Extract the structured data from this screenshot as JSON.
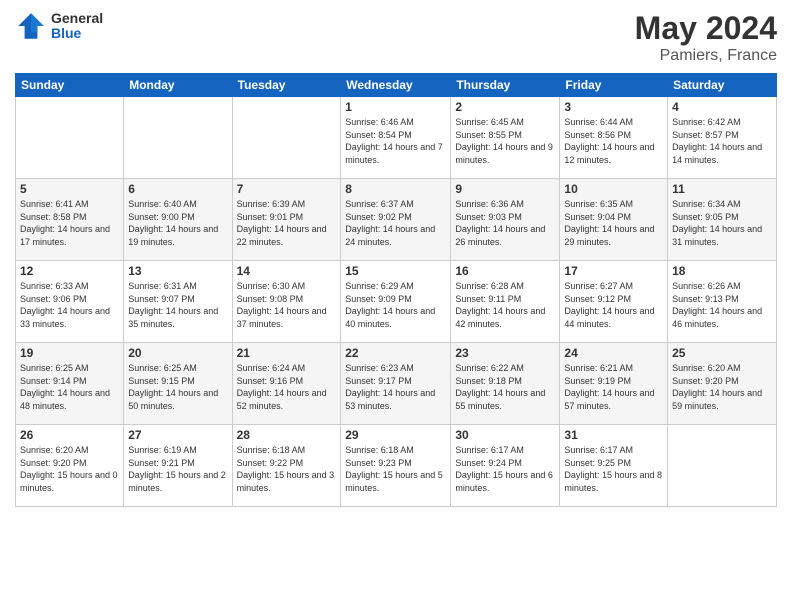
{
  "header": {
    "logo_general": "General",
    "logo_blue": "Blue",
    "month_title": "May 2024",
    "location": "Pamiers, France"
  },
  "days_of_week": [
    "Sunday",
    "Monday",
    "Tuesday",
    "Wednesday",
    "Thursday",
    "Friday",
    "Saturday"
  ],
  "weeks": [
    [
      {
        "day": "",
        "sunrise": "",
        "sunset": "",
        "daylight": ""
      },
      {
        "day": "",
        "sunrise": "",
        "sunset": "",
        "daylight": ""
      },
      {
        "day": "",
        "sunrise": "",
        "sunset": "",
        "daylight": ""
      },
      {
        "day": "1",
        "sunrise": "Sunrise: 6:46 AM",
        "sunset": "Sunset: 8:54 PM",
        "daylight": "Daylight: 14 hours and 7 minutes."
      },
      {
        "day": "2",
        "sunrise": "Sunrise: 6:45 AM",
        "sunset": "Sunset: 8:55 PM",
        "daylight": "Daylight: 14 hours and 9 minutes."
      },
      {
        "day": "3",
        "sunrise": "Sunrise: 6:44 AM",
        "sunset": "Sunset: 8:56 PM",
        "daylight": "Daylight: 14 hours and 12 minutes."
      },
      {
        "day": "4",
        "sunrise": "Sunrise: 6:42 AM",
        "sunset": "Sunset: 8:57 PM",
        "daylight": "Daylight: 14 hours and 14 minutes."
      }
    ],
    [
      {
        "day": "5",
        "sunrise": "Sunrise: 6:41 AM",
        "sunset": "Sunset: 8:58 PM",
        "daylight": "Daylight: 14 hours and 17 minutes."
      },
      {
        "day": "6",
        "sunrise": "Sunrise: 6:40 AM",
        "sunset": "Sunset: 9:00 PM",
        "daylight": "Daylight: 14 hours and 19 minutes."
      },
      {
        "day": "7",
        "sunrise": "Sunrise: 6:39 AM",
        "sunset": "Sunset: 9:01 PM",
        "daylight": "Daylight: 14 hours and 22 minutes."
      },
      {
        "day": "8",
        "sunrise": "Sunrise: 6:37 AM",
        "sunset": "Sunset: 9:02 PM",
        "daylight": "Daylight: 14 hours and 24 minutes."
      },
      {
        "day": "9",
        "sunrise": "Sunrise: 6:36 AM",
        "sunset": "Sunset: 9:03 PM",
        "daylight": "Daylight: 14 hours and 26 minutes."
      },
      {
        "day": "10",
        "sunrise": "Sunrise: 6:35 AM",
        "sunset": "Sunset: 9:04 PM",
        "daylight": "Daylight: 14 hours and 29 minutes."
      },
      {
        "day": "11",
        "sunrise": "Sunrise: 6:34 AM",
        "sunset": "Sunset: 9:05 PM",
        "daylight": "Daylight: 14 hours and 31 minutes."
      }
    ],
    [
      {
        "day": "12",
        "sunrise": "Sunrise: 6:33 AM",
        "sunset": "Sunset: 9:06 PM",
        "daylight": "Daylight: 14 hours and 33 minutes."
      },
      {
        "day": "13",
        "sunrise": "Sunrise: 6:31 AM",
        "sunset": "Sunset: 9:07 PM",
        "daylight": "Daylight: 14 hours and 35 minutes."
      },
      {
        "day": "14",
        "sunrise": "Sunrise: 6:30 AM",
        "sunset": "Sunset: 9:08 PM",
        "daylight": "Daylight: 14 hours and 37 minutes."
      },
      {
        "day": "15",
        "sunrise": "Sunrise: 6:29 AM",
        "sunset": "Sunset: 9:09 PM",
        "daylight": "Daylight: 14 hours and 40 minutes."
      },
      {
        "day": "16",
        "sunrise": "Sunrise: 6:28 AM",
        "sunset": "Sunset: 9:11 PM",
        "daylight": "Daylight: 14 hours and 42 minutes."
      },
      {
        "day": "17",
        "sunrise": "Sunrise: 6:27 AM",
        "sunset": "Sunset: 9:12 PM",
        "daylight": "Daylight: 14 hours and 44 minutes."
      },
      {
        "day": "18",
        "sunrise": "Sunrise: 6:26 AM",
        "sunset": "Sunset: 9:13 PM",
        "daylight": "Daylight: 14 hours and 46 minutes."
      }
    ],
    [
      {
        "day": "19",
        "sunrise": "Sunrise: 6:25 AM",
        "sunset": "Sunset: 9:14 PM",
        "daylight": "Daylight: 14 hours and 48 minutes."
      },
      {
        "day": "20",
        "sunrise": "Sunrise: 6:25 AM",
        "sunset": "Sunset: 9:15 PM",
        "daylight": "Daylight: 14 hours and 50 minutes."
      },
      {
        "day": "21",
        "sunrise": "Sunrise: 6:24 AM",
        "sunset": "Sunset: 9:16 PM",
        "daylight": "Daylight: 14 hours and 52 minutes."
      },
      {
        "day": "22",
        "sunrise": "Sunrise: 6:23 AM",
        "sunset": "Sunset: 9:17 PM",
        "daylight": "Daylight: 14 hours and 53 minutes."
      },
      {
        "day": "23",
        "sunrise": "Sunrise: 6:22 AM",
        "sunset": "Sunset: 9:18 PM",
        "daylight": "Daylight: 14 hours and 55 minutes."
      },
      {
        "day": "24",
        "sunrise": "Sunrise: 6:21 AM",
        "sunset": "Sunset: 9:19 PM",
        "daylight": "Daylight: 14 hours and 57 minutes."
      },
      {
        "day": "25",
        "sunrise": "Sunrise: 6:20 AM",
        "sunset": "Sunset: 9:20 PM",
        "daylight": "Daylight: 14 hours and 59 minutes."
      }
    ],
    [
      {
        "day": "26",
        "sunrise": "Sunrise: 6:20 AM",
        "sunset": "Sunset: 9:20 PM",
        "daylight": "Daylight: 15 hours and 0 minutes."
      },
      {
        "day": "27",
        "sunrise": "Sunrise: 6:19 AM",
        "sunset": "Sunset: 9:21 PM",
        "daylight": "Daylight: 15 hours and 2 minutes."
      },
      {
        "day": "28",
        "sunrise": "Sunrise: 6:18 AM",
        "sunset": "Sunset: 9:22 PM",
        "daylight": "Daylight: 15 hours and 3 minutes."
      },
      {
        "day": "29",
        "sunrise": "Sunrise: 6:18 AM",
        "sunset": "Sunset: 9:23 PM",
        "daylight": "Daylight: 15 hours and 5 minutes."
      },
      {
        "day": "30",
        "sunrise": "Sunrise: 6:17 AM",
        "sunset": "Sunset: 9:24 PM",
        "daylight": "Daylight: 15 hours and 6 minutes."
      },
      {
        "day": "31",
        "sunrise": "Sunrise: 6:17 AM",
        "sunset": "Sunset: 9:25 PM",
        "daylight": "Daylight: 15 hours and 8 minutes."
      },
      {
        "day": "",
        "sunrise": "",
        "sunset": "",
        "daylight": ""
      }
    ]
  ]
}
